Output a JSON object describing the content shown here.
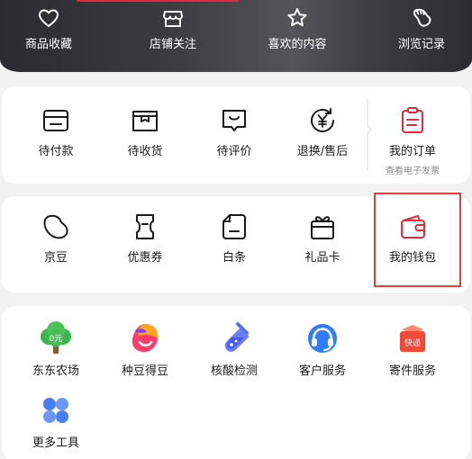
{
  "header": {
    "items": [
      {
        "label": "商品收藏",
        "icon": "heart-icon"
      },
      {
        "label": "店铺关注",
        "icon": "store-icon"
      },
      {
        "label": "喜欢的内容",
        "icon": "star-icon"
      },
      {
        "label": "浏览记录",
        "icon": "footprint-icon"
      }
    ]
  },
  "orders": {
    "items": [
      {
        "label": "待付款",
        "icon": "wallet-card-icon"
      },
      {
        "label": "待收货",
        "icon": "package-box-icon"
      },
      {
        "label": "待评价",
        "icon": "comment-bubble-icon"
      },
      {
        "label": "退换/售后",
        "icon": "yen-refresh-icon"
      },
      {
        "label": "我的订单",
        "sublabel": "查看电子发票",
        "icon": "clipboard-icon"
      }
    ]
  },
  "wallet": {
    "items": [
      {
        "label": "京豆",
        "icon": "bean-icon"
      },
      {
        "label": "优惠券",
        "icon": "coupon-icon"
      },
      {
        "label": "白条",
        "icon": "baitiao-icon"
      },
      {
        "label": "礼品卡",
        "icon": "gift-card-icon"
      },
      {
        "label": "我的钱包",
        "icon": "wallet-icon"
      }
    ]
  },
  "tools": {
    "items": [
      {
        "label": "东东农场",
        "icon": "farm-tree-icon",
        "badge": "0元"
      },
      {
        "label": "种豆得豆",
        "icon": "bean-plant-icon"
      },
      {
        "label": "核酸检测",
        "icon": "test-tube-icon"
      },
      {
        "label": "客户服务",
        "icon": "headset-icon"
      },
      {
        "label": "寄件服务",
        "icon": "express-box-icon",
        "badge": "快递"
      },
      {
        "label": "更多工具",
        "icon": "more-grid-icon"
      }
    ]
  },
  "colors": {
    "accent": "#e3293a",
    "highlight_border": "#e0403c"
  }
}
